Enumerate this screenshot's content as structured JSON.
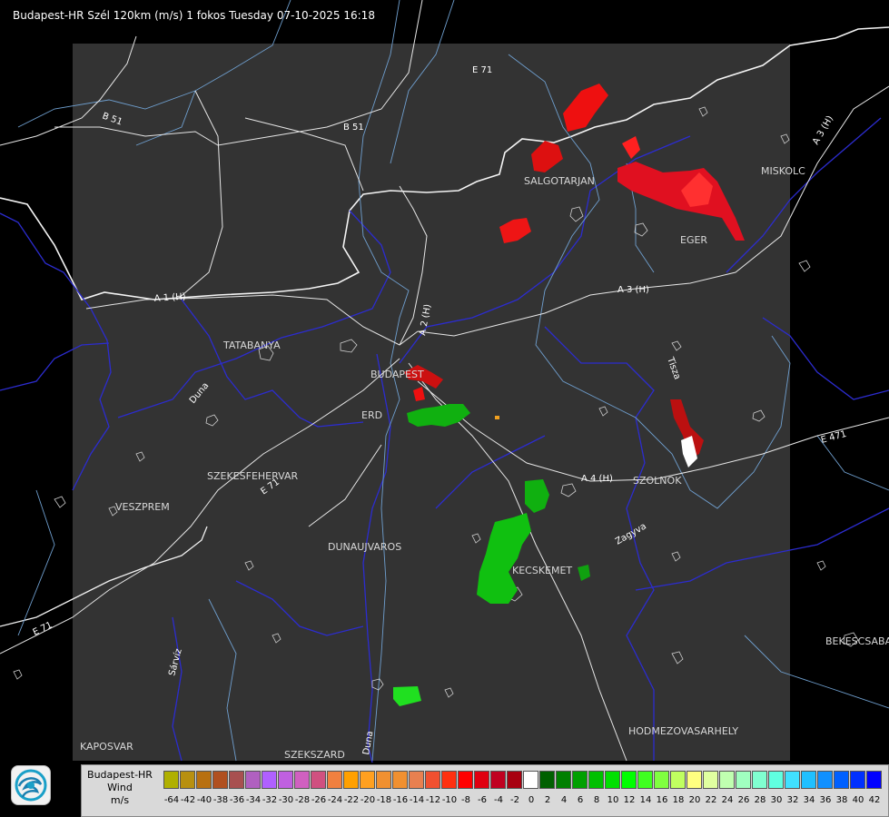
{
  "header": {
    "title": "Budapest-HR Szél 120km (m/s) 1 fokos Tuesday 07-10-2025 16:18"
  },
  "map": {
    "cities": [
      {
        "id": "salgotarjan",
        "label": "SALGOTARJAN"
      },
      {
        "id": "miskolc",
        "label": "MISKOLC"
      },
      {
        "id": "eger",
        "label": "EGER"
      },
      {
        "id": "tatabanya",
        "label": "TATABANYA"
      },
      {
        "id": "budapest",
        "label": "BUDAPEST"
      },
      {
        "id": "erd",
        "label": "ERD"
      },
      {
        "id": "szekesfehervar",
        "label": "SZEKESFEHERVAR"
      },
      {
        "id": "veszprem",
        "label": "VESZPREM"
      },
      {
        "id": "szolnok",
        "label": "SZOLNOK"
      },
      {
        "id": "dunaujvaros",
        "label": "DUNAUJVAROS"
      },
      {
        "id": "kecskemet",
        "label": "KECSKEMET"
      },
      {
        "id": "bekescsaba",
        "label": "BEKESCSABA"
      },
      {
        "id": "hodmezovasarhely",
        "label": "HODMEZOVASARHELY"
      },
      {
        "id": "kaposvar",
        "label": "KAPOSVAR"
      },
      {
        "id": "szekszard",
        "label": "SZEKSZARD"
      }
    ],
    "roads": [
      "B 51",
      "B 51",
      "A 3 (H)",
      "A 3 (H)",
      "A 1 (H)",
      "A 2 (H)",
      "A 4 (H)",
      "E 71",
      "E 71",
      "E 71",
      "E 471"
    ],
    "rivers": [
      "Duna",
      "Tisza",
      "Zagyva",
      "Sárvíz",
      "Duna"
    ],
    "background_color": "#000000",
    "coverage_color": "#333333"
  },
  "legend": {
    "station": "Budapest-HR",
    "quantity": "Wind",
    "unit": "m/s",
    "entries": [
      {
        "value": "-64",
        "color": "#b0b000"
      },
      {
        "value": "-42",
        "color": "#b89010"
      },
      {
        "value": "-40",
        "color": "#b87010"
      },
      {
        "value": "-38",
        "color": "#b05020"
      },
      {
        "value": "-36",
        "color": "#a85050"
      },
      {
        "value": "-34",
        "color": "#b060c0"
      },
      {
        "value": "-32",
        "color": "#b060ff"
      },
      {
        "value": "-30",
        "color": "#c060e0"
      },
      {
        "value": "-28",
        "color": "#d060c0"
      },
      {
        "value": "-26",
        "color": "#d05080"
      },
      {
        "value": "-24",
        "color": "#f08040"
      },
      {
        "value": "-22",
        "color": "#ffa000"
      },
      {
        "value": "-20",
        "color": "#ffa020"
      },
      {
        "value": "-18",
        "color": "#f09030"
      },
      {
        "value": "-16",
        "color": "#f09030"
      },
      {
        "value": "-14",
        "color": "#e88050"
      },
      {
        "value": "-12",
        "color": "#f05030"
      },
      {
        "value": "-10",
        "color": "#ff3010"
      },
      {
        "value": "-8",
        "color": "#ff0000"
      },
      {
        "value": "-6",
        "color": "#e00010"
      },
      {
        "value": "-4",
        "color": "#c00020"
      },
      {
        "value": "-2",
        "color": "#a80010"
      },
      {
        "value": "0",
        "color": "#ffffff"
      },
      {
        "value": "2",
        "color": "#006000"
      },
      {
        "value": "4",
        "color": "#008000"
      },
      {
        "value": "6",
        "color": "#00a000"
      },
      {
        "value": "8",
        "color": "#00c000"
      },
      {
        "value": "10",
        "color": "#00e000"
      },
      {
        "value": "12",
        "color": "#00ff00"
      },
      {
        "value": "14",
        "color": "#40ff20"
      },
      {
        "value": "16",
        "color": "#80ff40"
      },
      {
        "value": "18",
        "color": "#c0ff60"
      },
      {
        "value": "20",
        "color": "#ffff80"
      },
      {
        "value": "22",
        "color": "#e0ffa0"
      },
      {
        "value": "24",
        "color": "#c0ffb0"
      },
      {
        "value": "26",
        "color": "#a0ffc0"
      },
      {
        "value": "28",
        "color": "#80ffd0"
      },
      {
        "value": "30",
        "color": "#60ffe0"
      },
      {
        "value": "32",
        "color": "#40e0ff"
      },
      {
        "value": "34",
        "color": "#20c0ff"
      },
      {
        "value": "36",
        "color": "#1090ff"
      },
      {
        "value": "38",
        "color": "#0060ff"
      },
      {
        "value": "40",
        "color": "#0030ff"
      },
      {
        "value": "42",
        "color": "#0000ff"
      }
    ]
  }
}
